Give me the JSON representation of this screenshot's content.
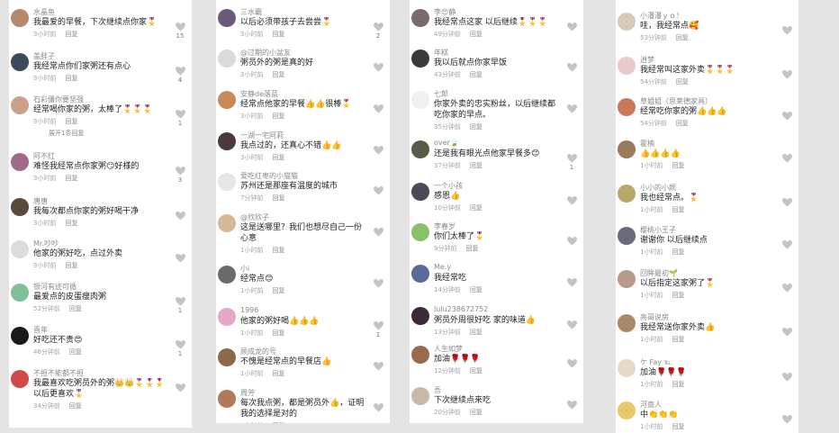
{
  "heart_color": "#c4c4c4",
  "columns": [
    {
      "comments": [
        {
          "name": "水晶鱼",
          "text": "我最爱的早餐，下次继续点你家🎖️",
          "time": "3小时前",
          "reply": "回复",
          "likes": "15",
          "avatar_color": "#b58a6a"
        },
        {
          "name": "盖胖子",
          "text": "我经常点你们家粥还有点心",
          "time": "3小时前",
          "reply": "回复",
          "likes": "4",
          "avatar_color": "#3a4a5a"
        },
        {
          "name": "石彩僵你要坚强",
          "text": "经常喝你家的粥，太棒了🎖️🎖️🎖️",
          "time": "3小时前",
          "reply": "回复",
          "likes": "1",
          "avatar_color": "#c9a08a",
          "more": "展开1条回复"
        },
        {
          "name": "阿不红",
          "text": "难怪我经常点你家粥😏好様的",
          "time": "3小时前",
          "reply": "回复",
          "likes": "3",
          "avatar_color": "#a06a8a"
        },
        {
          "name": "唐唐",
          "text": "我每次都点你家的粥好喝干净",
          "time": "3小时前",
          "reply": "回复",
          "likes": "",
          "avatar_color": "#5a4a3a"
        },
        {
          "name": "Mr.吵吵",
          "text": "他家的粥好吃，点过外卖",
          "time": "3小时前",
          "reply": "回复",
          "likes": "",
          "avatar_color": "#dcdcdc"
        },
        {
          "name": "银河有迹可循",
          "text": "最爱点的皮蛋瘦肉粥",
          "time": "52分钟前",
          "reply": "回复",
          "likes": "1",
          "avatar_color": "#7fbf9a"
        },
        {
          "name": "晋年",
          "text": "好吃还不贵😍",
          "time": "46分钟前",
          "reply": "回复",
          "likes": "1",
          "avatar_color": "#1a1a1a"
        },
        {
          "name": "不担不能都不担",
          "text": "我最喜欢吃粥员外的粥👑👑🎖️🎖️🎖️ 以后更喜欢🎖️",
          "time": "34分钟前",
          "reply": "回复",
          "likes": "",
          "avatar_color": "#d04a4a"
        }
      ]
    },
    {
      "comments": [
        {
          "name": "三水霸",
          "text": "以后必须带孩子去尝尝🎖️",
          "time": "3小时前",
          "reply": "回复",
          "likes": "2",
          "avatar_color": "#6a5a7a"
        },
        {
          "name": "@过期的小盆友",
          "text": "粥员外的粥是真的好",
          "time": "3小时前",
          "reply": "回复",
          "likes": "",
          "avatar_color": "#dadada"
        },
        {
          "name": "安静de落蓝",
          "text": "经常点他家的早餐👍👍很棒🎖️",
          "time": "3小时前",
          "reply": "回复",
          "likes": "",
          "avatar_color": "#c98a5a"
        },
        {
          "name": "一湖一宅阿莉",
          "text": "我点过的，还真心不错👍👍",
          "time": "3小时前",
          "reply": "回复",
          "likes": "",
          "avatar_color": "#4a3a3a"
        },
        {
          "name": "爱吃红枣的小猫猫",
          "text": "苏州还是那座有温度的城市",
          "time": "7分钟前",
          "reply": "回复",
          "likes": "",
          "avatar_color": "#e6e6e6"
        },
        {
          "name": "@欣欣子",
          "text": "这是送哪里？我们也想尽自己一份心意",
          "time": "1小时前",
          "reply": "回复",
          "likes": "",
          "avatar_color": "#d8b89a"
        },
        {
          "name": "小i",
          "text": "经常点😊",
          "time": "1小时前",
          "reply": "回复",
          "likes": "",
          "avatar_color": "#6a6a6a"
        },
        {
          "name": "1996",
          "text": "他家的粥好喝👍👍👍",
          "time": "1小时前",
          "reply": "回复",
          "likes": "1",
          "avatar_color": "#e6a8c8"
        },
        {
          "name": "顾成龙的号",
          "text": "不愧是经常点的早餐店👍",
          "time": "1小时前",
          "reply": "回复",
          "likes": "",
          "avatar_color": "#8a6a4a"
        },
        {
          "name": "周芳",
          "text": "每次我点粥，都是粥员外👍，证明我的选择是对的",
          "time": "1小时前",
          "reply": "回复",
          "likes": "",
          "avatar_color": "#b07a5a"
        }
      ]
    },
    {
      "comments": [
        {
          "name": "李😍静",
          "text": "我经常点这家 以后继续🎖️🎖️🎖️",
          "time": "49分钟前",
          "reply": "回复",
          "likes": "",
          "avatar_color": "#7a6a6a"
        },
        {
          "name": "年糕",
          "text": "我以后就点你家早饭",
          "time": "43分钟前",
          "reply": "回复",
          "likes": "",
          "avatar_color": "#3a3a3a"
        },
        {
          "name": "七郎",
          "text": "你家外卖的忠实粉丝，以后继续都吃你家的早点。",
          "time": "35分钟前",
          "reply": "回复",
          "likes": "",
          "avatar_color": "#efefef"
        },
        {
          "name": "over🍃",
          "text": "还是我有眼光点他家早餐多😊",
          "time": "37分钟前",
          "reply": "回复",
          "likes": "1",
          "avatar_color": "#5a5a4a"
        },
        {
          "name": "一个小孩",
          "text": "感恩👍",
          "time": "10分钟前",
          "reply": "回复",
          "likes": "",
          "avatar_color": "#4a4a5a"
        },
        {
          "name": "李春岁",
          "text": "你们太棒了🎖️",
          "time": "9分钟前",
          "reply": "回复",
          "likes": "",
          "avatar_color": "#8ac06a"
        },
        {
          "name": "Me.y",
          "text": "我经常吃",
          "time": "14分钟前",
          "reply": "回复",
          "likes": "",
          "avatar_color": "#5a6a9a"
        },
        {
          "name": "lulu238672752",
          "text": "粥员外周很好吃 家的味道👍",
          "time": "13分钟前",
          "reply": "回复",
          "likes": "",
          "avatar_color": "#3a2a3a"
        },
        {
          "name": "人生如梦",
          "text": "加油🌹🌹🌹",
          "time": "12分钟前",
          "reply": "回复",
          "likes": "",
          "avatar_color": "#9a6a4a"
        },
        {
          "name": "吾",
          "text": "下次继续点来吃",
          "time": "20分钟前",
          "reply": "回复",
          "likes": "",
          "avatar_color": "#c8b8a8"
        }
      ]
    },
    {
      "comments": [
        {
          "name": "小潘潘ｙｏ！",
          "text": "哇，我经常点🥰",
          "time": "53分钟前",
          "reply": "回复",
          "likes": "",
          "avatar_color": "#d8c8b8"
        },
        {
          "name": "逍梦",
          "text": "我经常叫这家外卖🎖️🎖️🎖️",
          "time": "54分钟前",
          "reply": "回复",
          "likes": "",
          "avatar_color": "#e8c8c8"
        },
        {
          "name": "草姐姐（思莱德家具）",
          "text": "经常吃你家的粥👍👍👍",
          "time": "54分钟前",
          "reply": "回复",
          "likes": "",
          "avatar_color": "#c87a5a"
        },
        {
          "name": "霍楠",
          "text": "👍👍👍👍",
          "time": "1小时前",
          "reply": "回复",
          "likes": "",
          "avatar_color": "#9a7a5a"
        },
        {
          "name": "小小的小颜",
          "text": "我也经常点。🎖️",
          "time": "1小时前",
          "reply": "回复",
          "likes": "",
          "avatar_color": "#b8a86a"
        },
        {
          "name": "樱桃小王子",
          "text": "谢谢你 以后继续点",
          "time": "1小时前",
          "reply": "回复",
          "likes": "",
          "avatar_color": "#6a6a7a"
        },
        {
          "name": "回眸最初🌱",
          "text": "以后指定这家粥了🎖️",
          "time": "1小时前",
          "reply": "回复",
          "likes": "",
          "avatar_color": "#b89a8a"
        },
        {
          "name": "亮哥说房",
          "text": "我经常送你家外卖👍",
          "time": "1小时前",
          "reply": "回复",
          "likes": "",
          "avatar_color": "#a88a6a"
        },
        {
          "name": "ケ Fay ℡",
          "text": "加油🌹🌹🌹",
          "time": "1小时前",
          "reply": "回复",
          "likes": "",
          "avatar_color": "#e8d8c8"
        },
        {
          "name": "河南人",
          "text": "中👏👏👏",
          "time": "1小时前",
          "reply": "回复",
          "likes": "",
          "avatar_color": "#e8c86a"
        }
      ]
    }
  ]
}
